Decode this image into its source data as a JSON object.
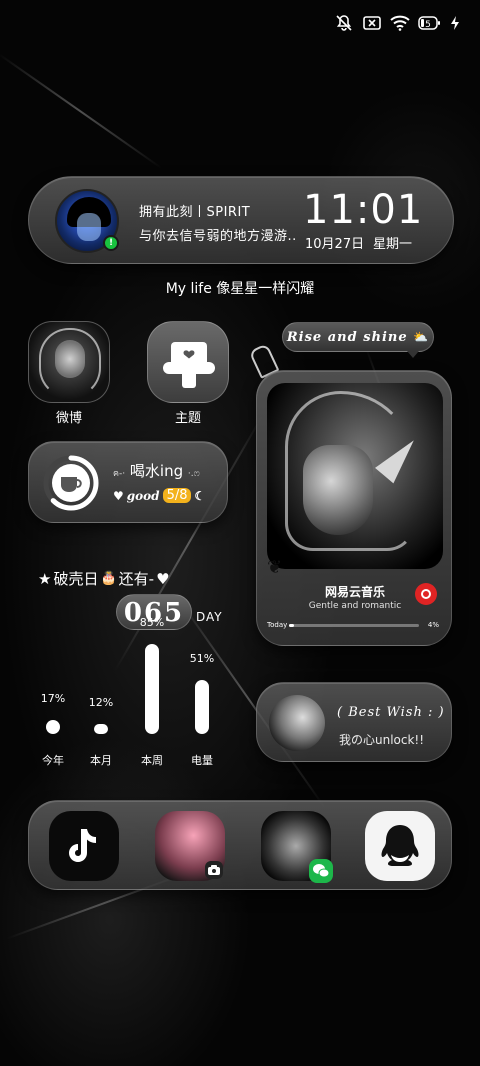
{
  "status_bar": {
    "icons": [
      "mute-icon",
      "no-sim-icon",
      "wifi-icon",
      "battery-icon",
      "charging-icon"
    ],
    "battery_level": "5"
  },
  "profile_widget": {
    "name": "拥有此刻丨SPIRIT",
    "signature": "与你去信号弱的地方漫游..",
    "time": "11:01",
    "date": "10月27日",
    "weekday": "星期一",
    "online_mark": "!"
  },
  "motto": "My life 像星星一样闪耀",
  "apps": {
    "weibo": "微博",
    "theme": "主题"
  },
  "water": {
    "prefix": "ฅ-·",
    "title": "喝水ing",
    "suffix": "·.ෆ",
    "good": "good",
    "count": "5/8",
    "progress": 0.625
  },
  "countdown": {
    "title": "破壳日",
    "title_suffix": "还有-",
    "days": "065",
    "unit": "DAY"
  },
  "stats": [
    {
      "label": "今年",
      "pct": "17%",
      "value": 0.17
    },
    {
      "label": "本月",
      "pct": "12%",
      "value": 0.12
    },
    {
      "label": "本周",
      "pct": "85%",
      "value": 0.85
    },
    {
      "label": "电量",
      "pct": "51%",
      "value": 0.51
    }
  ],
  "music": {
    "bubble": "Rise and shine",
    "app_name": "网易云音乐",
    "subtitle": "Gentle and romantic",
    "progress_label": "Today",
    "progress_pct": "4%",
    "progress": 0.04
  },
  "wish": {
    "title": "( Best  Wish : )",
    "subtitle": "我の心unlock!!"
  },
  "colors": {
    "online": "#19c23f",
    "accent": "#f3b21c",
    "netease": "#e02424",
    "wechat": "#1db74a"
  }
}
